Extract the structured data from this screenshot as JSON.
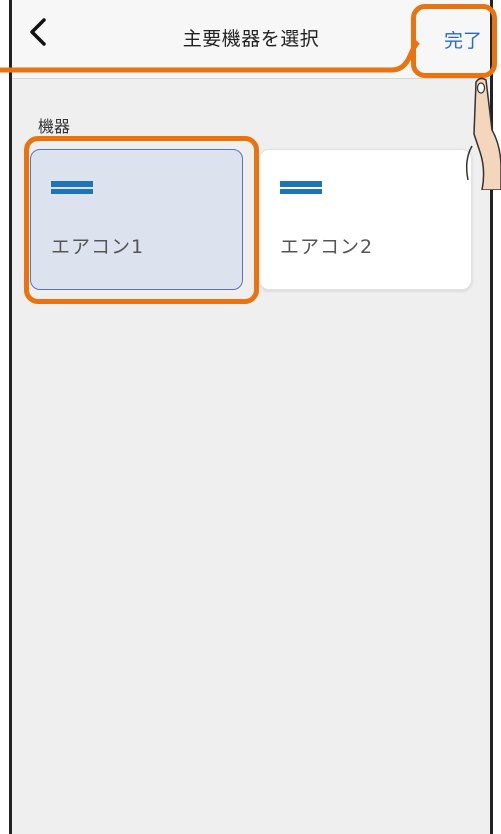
{
  "header": {
    "back_icon": "chevron-left-icon",
    "title": "主要機器を選択",
    "done_label": "完了"
  },
  "section": {
    "label": "機器"
  },
  "devices": [
    {
      "label": "エアコン1",
      "selected": true,
      "icon": "air-conditioner-icon"
    },
    {
      "label": "エアコン2",
      "selected": false,
      "icon": "air-conditioner-icon"
    }
  ],
  "colors": {
    "accent": "#2f67c9",
    "highlight": "#e8730f",
    "icon_blue": "#1e74b5",
    "selected_bg": "#dde2ef"
  }
}
